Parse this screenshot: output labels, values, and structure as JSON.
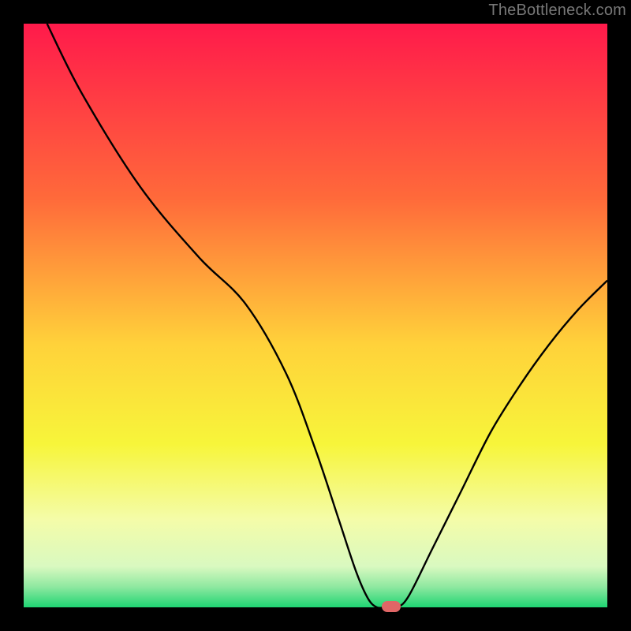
{
  "watermark": "TheBottleneck.com",
  "colors": {
    "frame": "#000000",
    "watermark": "#777777",
    "curve": "#000000",
    "marker": "#e06666",
    "gradient_stops": [
      {
        "offset": 0.0,
        "color": "#ff1a4b"
      },
      {
        "offset": 0.3,
        "color": "#ff6a3a"
      },
      {
        "offset": 0.55,
        "color": "#ffd23a"
      },
      {
        "offset": 0.72,
        "color": "#f7f53a"
      },
      {
        "offset": 0.85,
        "color": "#f4fca9"
      },
      {
        "offset": 0.93,
        "color": "#d9f9c0"
      },
      {
        "offset": 0.965,
        "color": "#8ee8a0"
      },
      {
        "offset": 1.0,
        "color": "#1fd573"
      }
    ]
  },
  "chart_data": {
    "type": "line",
    "title": "",
    "xlabel": "",
    "ylabel": "",
    "xlim": [
      0,
      100
    ],
    "ylim": [
      0,
      100
    ],
    "grid": false,
    "legend": false,
    "x": [
      4,
      10,
      20,
      30,
      38,
      45,
      50,
      54,
      57,
      59,
      60.5,
      62,
      64,
      66,
      70,
      75,
      80,
      85,
      90,
      95,
      100
    ],
    "values": [
      100,
      88,
      72,
      60,
      52,
      40,
      27,
      15,
      6,
      1.5,
      0,
      0,
      0,
      2,
      10,
      20,
      30,
      38,
      45,
      51,
      56
    ],
    "marker": {
      "x": 63,
      "y": 0
    },
    "note": "x is horizontal position in % of plot width (0=left, 100=right); values are vertical position in % of plot height (0=bottom baseline, 100=top). Curve enters at top-left, kinks around x≈30, dives to a flat minimum near x≈60–65 at the baseline, then rises toward the right edge at roughly y≈56."
  }
}
